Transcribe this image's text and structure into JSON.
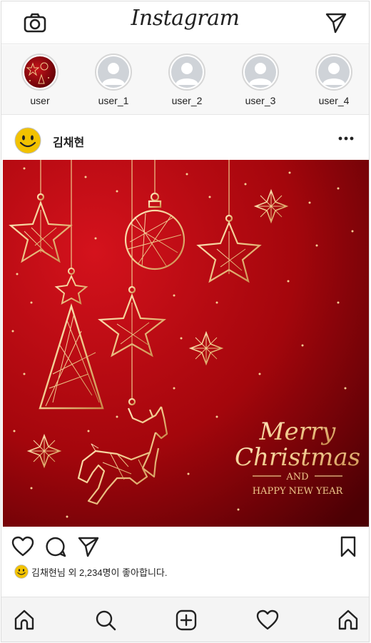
{
  "header": {
    "logo": "Instagram",
    "camera_icon": "camera-icon",
    "direct_icon": "send-icon"
  },
  "stories": [
    {
      "name": "user",
      "type": "image"
    },
    {
      "name": "user_1",
      "type": "default-avatar"
    },
    {
      "name": "user_2",
      "type": "default-avatar"
    },
    {
      "name": "user_3",
      "type": "default-avatar"
    },
    {
      "name": "user_4",
      "type": "default-avatar"
    }
  ],
  "post": {
    "author": "김채현",
    "more_icon": "more-horizontal-icon",
    "image": {
      "line1": "Merry",
      "line2": "Christmas",
      "line3": "AND",
      "line4": "HAPPY NEW YEAR"
    },
    "likes_text": "김채현님 외 2,234명이 좋아합니다."
  },
  "actions": {
    "like_icon": "heart-icon",
    "comment_icon": "comment-icon",
    "share_icon": "send-icon",
    "save_icon": "bookmark-icon"
  },
  "bottom_nav": [
    "home-icon",
    "search-icon",
    "add-post-icon",
    "heart-icon",
    "home-icon"
  ],
  "colors": {
    "accent_red": "#a4060c",
    "gold": "#f0c98c",
    "smiley_yellow": "#f2c200"
  }
}
